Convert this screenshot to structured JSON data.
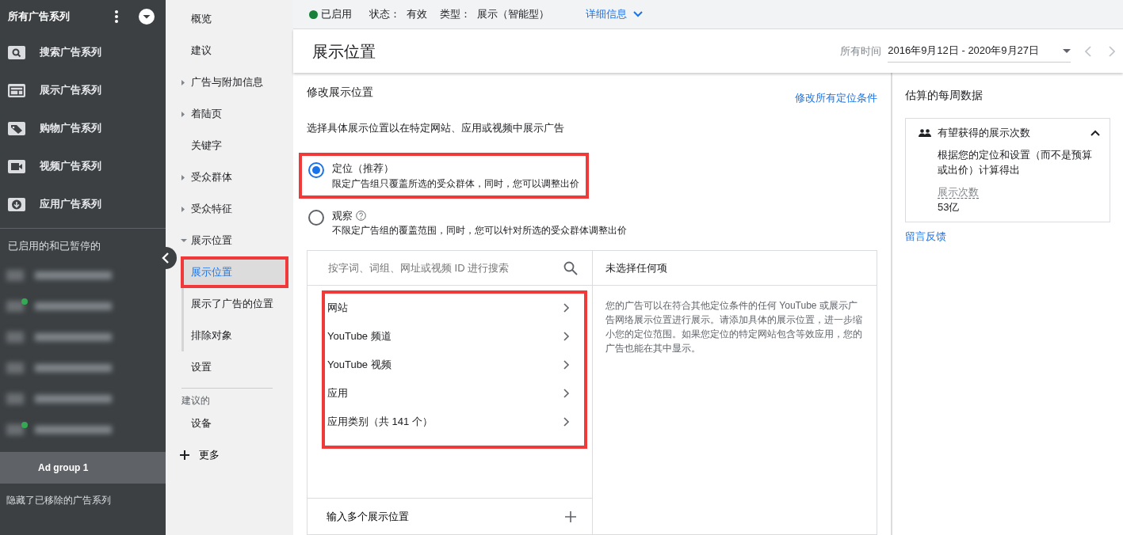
{
  "sidebar": {
    "title": "所有广告系列",
    "campaign_types": [
      {
        "kind": "search",
        "label": "搜索广告系列"
      },
      {
        "kind": "display",
        "label": "展示广告系列"
      },
      {
        "kind": "shopping",
        "label": "购物广告系列"
      },
      {
        "kind": "video",
        "label": "视频广告系列"
      },
      {
        "kind": "app",
        "label": "应用广告系列"
      }
    ],
    "section_label": "已启用的和已暂停的",
    "blurred_campaigns": [
      {
        "active": false
      },
      {
        "active": true
      },
      {
        "active": false
      },
      {
        "active": false
      },
      {
        "active": false
      },
      {
        "active": true
      }
    ],
    "ad_group": {
      "label": "Ad group 1",
      "selected": true
    },
    "footer": "隐藏了已移除的广告系列"
  },
  "nav": {
    "items": [
      {
        "label": "概览",
        "kind": "leaf"
      },
      {
        "label": "建议",
        "kind": "leaf"
      },
      {
        "label": "广告与附加信息",
        "kind": "group",
        "expanded": false
      },
      {
        "label": "着陆页",
        "kind": "group",
        "expanded": false
      },
      {
        "label": "关键字",
        "kind": "leaf"
      },
      {
        "label": "受众群体",
        "kind": "group",
        "expanded": false
      },
      {
        "label": "受众特征",
        "kind": "group",
        "expanded": false
      },
      {
        "label": "展示位置",
        "kind": "group",
        "expanded": true,
        "children": [
          {
            "label": "展示位置",
            "selected": true,
            "highlighted": true
          },
          {
            "label": "展示了广告的位置",
            "selected": false,
            "highlighted": false
          },
          {
            "label": "排除对象",
            "selected": false,
            "highlighted": false
          }
        ]
      },
      {
        "label": "设置",
        "kind": "leaf"
      }
    ],
    "suggested_label": "建议的",
    "suggested": [
      {
        "label": "设备"
      }
    ],
    "more": "更多"
  },
  "status_bar": {
    "status": "已启用",
    "state_label": "状态：",
    "state_value": "有效",
    "type_label": "类型：",
    "type_value": "展示（智能型）",
    "details_link": "详细信息"
  },
  "header": {
    "title": "展示位置",
    "range_label": "所有时间",
    "date_range": "2016年9月12日 - 2020年9月27日"
  },
  "placements": {
    "title": "修改展示位置",
    "edit_all_link": "修改所有定位条件",
    "description": "选择具体展示位置以在特定网站、应用或视频中展示广告",
    "options": [
      {
        "label": "定位（推荐）",
        "hint": "限定广告组只覆盖所选的受众群体，同时，您可以调整出价",
        "selected": true,
        "help": false,
        "highlighted": true
      },
      {
        "label": "观察",
        "hint": "不限定广告组的覆盖范围，同时，您可以针对所选的受众群体调整出价",
        "selected": false,
        "help": true,
        "highlighted": false
      }
    ],
    "search_placeholder": "按字词、词组、网址或视频 ID 进行搜索",
    "categories": [
      {
        "label": "网站"
      },
      {
        "label": "YouTube 频道"
      },
      {
        "label": "YouTube 视频"
      },
      {
        "label": "应用"
      },
      {
        "label": "应用类别（共 141 个）"
      }
    ],
    "categories_highlighted": true,
    "multi_entry": "输入多个展示位置",
    "selection_title": "未选择任何项",
    "selection_note": "您的广告可以在符合其他定位条件的任何 YouTube 或展示广告网络展示位置进行展示。请添加具体的展示位置，进一步缩小您的定位范围。如果您定位的特定网站包含等效应用，您的广告也能在其中显示。"
  },
  "estimates": {
    "title": "估算的每周数据",
    "card_title": "有望获得的展示次数",
    "expanded": true,
    "card_text": "根据您的定位和设置（而不是预算或出价）计算得出",
    "metric_label": "展示次数",
    "metric_value": "53亿",
    "feedback_link": "留言反馈"
  }
}
